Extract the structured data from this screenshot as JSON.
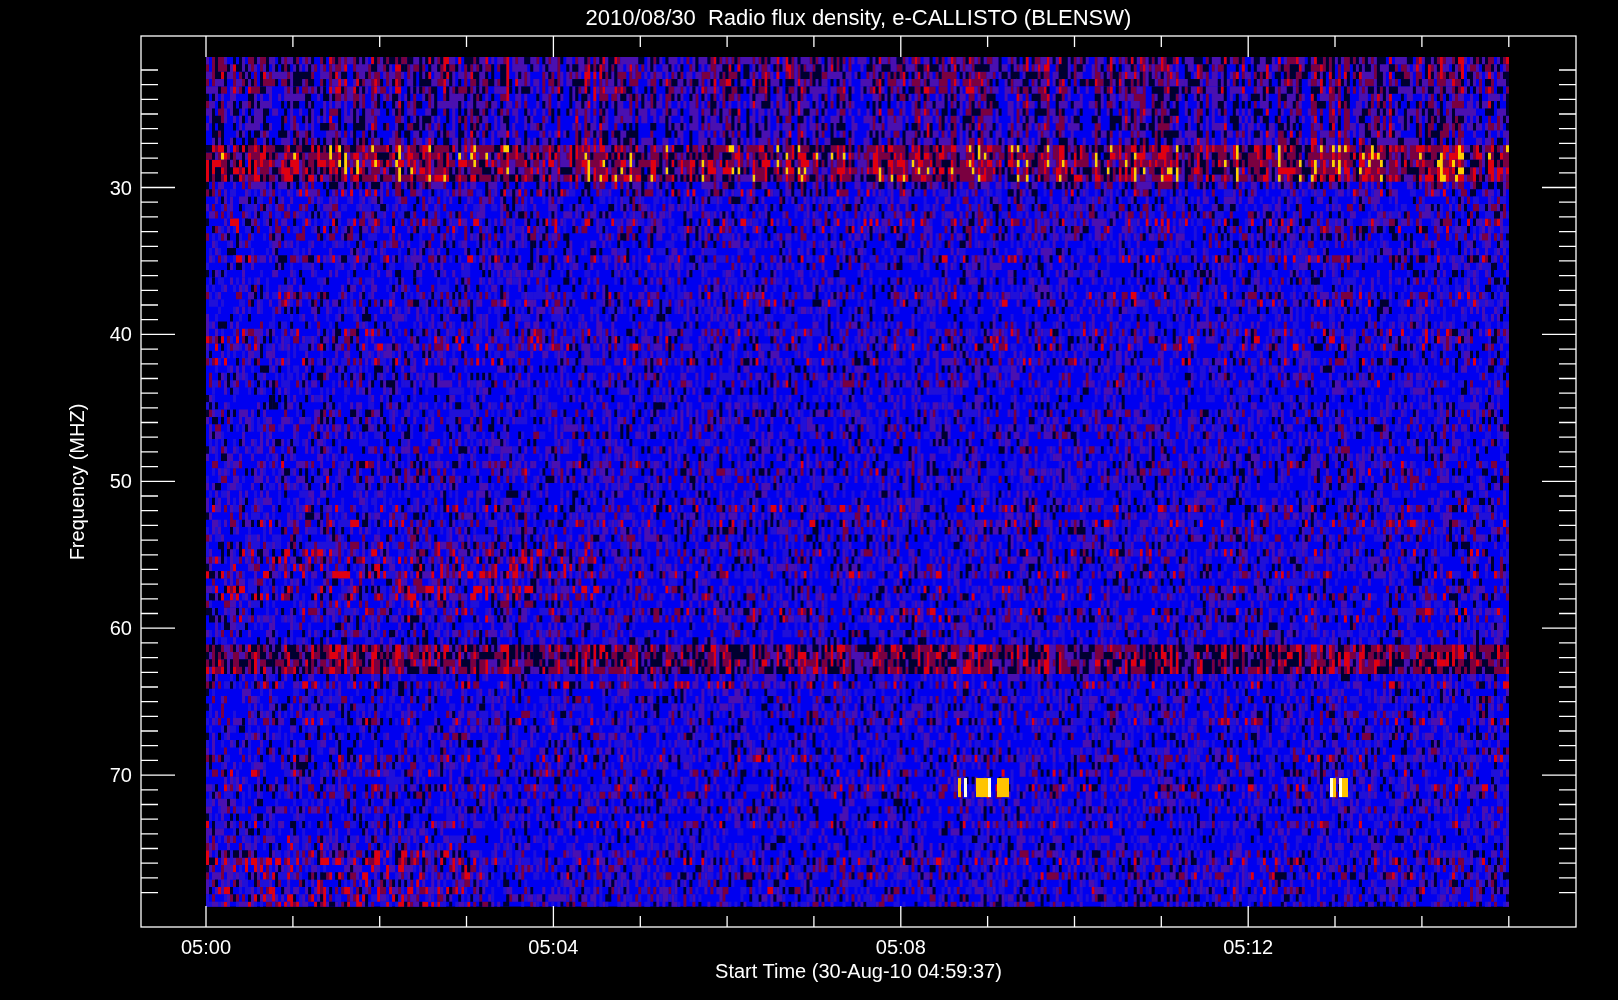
{
  "plot": {
    "title": "2010/08/30  Radio flux density, e-CALLISTO (BLENSW)",
    "ylabel": "Frequency (MHZ)",
    "xlabel": "Start Time (30-Aug-10 04:59:37)",
    "yticks": [
      "30",
      "40",
      "50",
      "60",
      "70"
    ],
    "xticks": [
      "05:00",
      "05:04",
      "05:08",
      "05:12"
    ]
  }
}
